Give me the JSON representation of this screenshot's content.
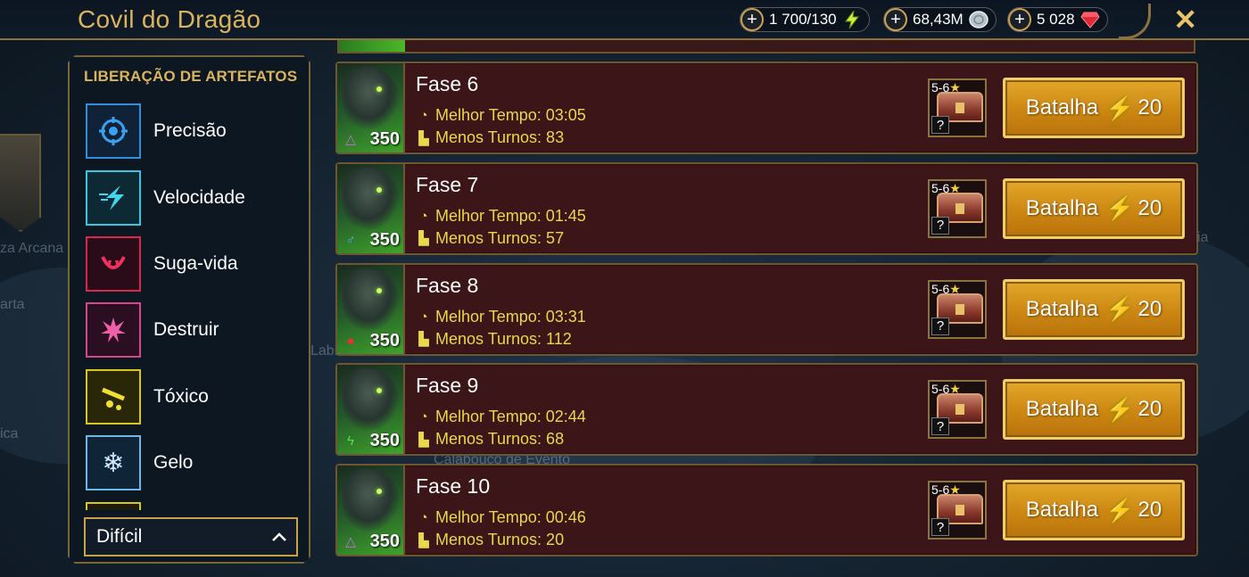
{
  "header": {
    "title": "Covil do Dragão",
    "resources": [
      {
        "name": "energy",
        "value": "1 700/130",
        "icon": "lightning-icon"
      },
      {
        "name": "silver",
        "value": "68,43M",
        "icon": "silver-coin-icon"
      },
      {
        "name": "gems",
        "value": "5 028",
        "icon": "ruby-icon"
      }
    ],
    "close": "✕"
  },
  "sidebar": {
    "header": "LIBERAÇÃO DE ARTEFATOS",
    "items": [
      {
        "label": "Precisão",
        "icon": "accuracy-icon",
        "color": "#2f8fd8"
      },
      {
        "label": "Velocidade",
        "icon": "speed-icon",
        "color": "#37c6e0"
      },
      {
        "label": "Suga-vida",
        "icon": "lifesteal-icon",
        "color": "#d8264e"
      },
      {
        "label": "Destruir",
        "icon": "destroy-icon",
        "color": "#d8468a"
      },
      {
        "label": "Tóxico",
        "icon": "toxic-icon",
        "color": "#d8c81e"
      },
      {
        "label": "Gelo",
        "icon": "frost-icon",
        "color": "#6fb6e8"
      }
    ],
    "difficulty": "Difícil"
  },
  "stages": [
    {
      "name": "Fase 6",
      "level": "350",
      "affinity": "magic",
      "best_time": "Melhor Tempo: 03:05",
      "min_turns": "Menos Turnos: 83",
      "rank": "5-6",
      "battle": "Batalha",
      "cost": "20"
    },
    {
      "name": "Fase 7",
      "level": "350",
      "affinity": "force",
      "best_time": "Melhor Tempo: 01:45",
      "min_turns": "Menos Turnos: 57",
      "rank": "5-6",
      "battle": "Batalha",
      "cost": "20"
    },
    {
      "name": "Fase 8",
      "level": "350",
      "affinity": "void",
      "best_time": "Melhor Tempo: 03:31",
      "min_turns": "Menos Turnos: 112",
      "rank": "5-6",
      "battle": "Batalha",
      "cost": "20"
    },
    {
      "name": "Fase 9",
      "level": "350",
      "affinity": "spirit",
      "best_time": "Melhor Tempo: 02:44",
      "min_turns": "Menos Turnos: 68",
      "rank": "5-6",
      "battle": "Batalha",
      "cost": "20"
    },
    {
      "name": "Fase 10",
      "level": "350",
      "affinity": "magic",
      "best_time": "Melhor Tempo: 00:46",
      "min_turns": "Menos Turnos: 20",
      "rank": "5-6",
      "battle": "Batalha",
      "cost": "20"
    }
  ],
  "background": {
    "map_labels": [
      "za Arcana",
      "arta",
      "ica",
      "Labi",
      "Calabouço de Evento",
      "ia"
    ]
  }
}
